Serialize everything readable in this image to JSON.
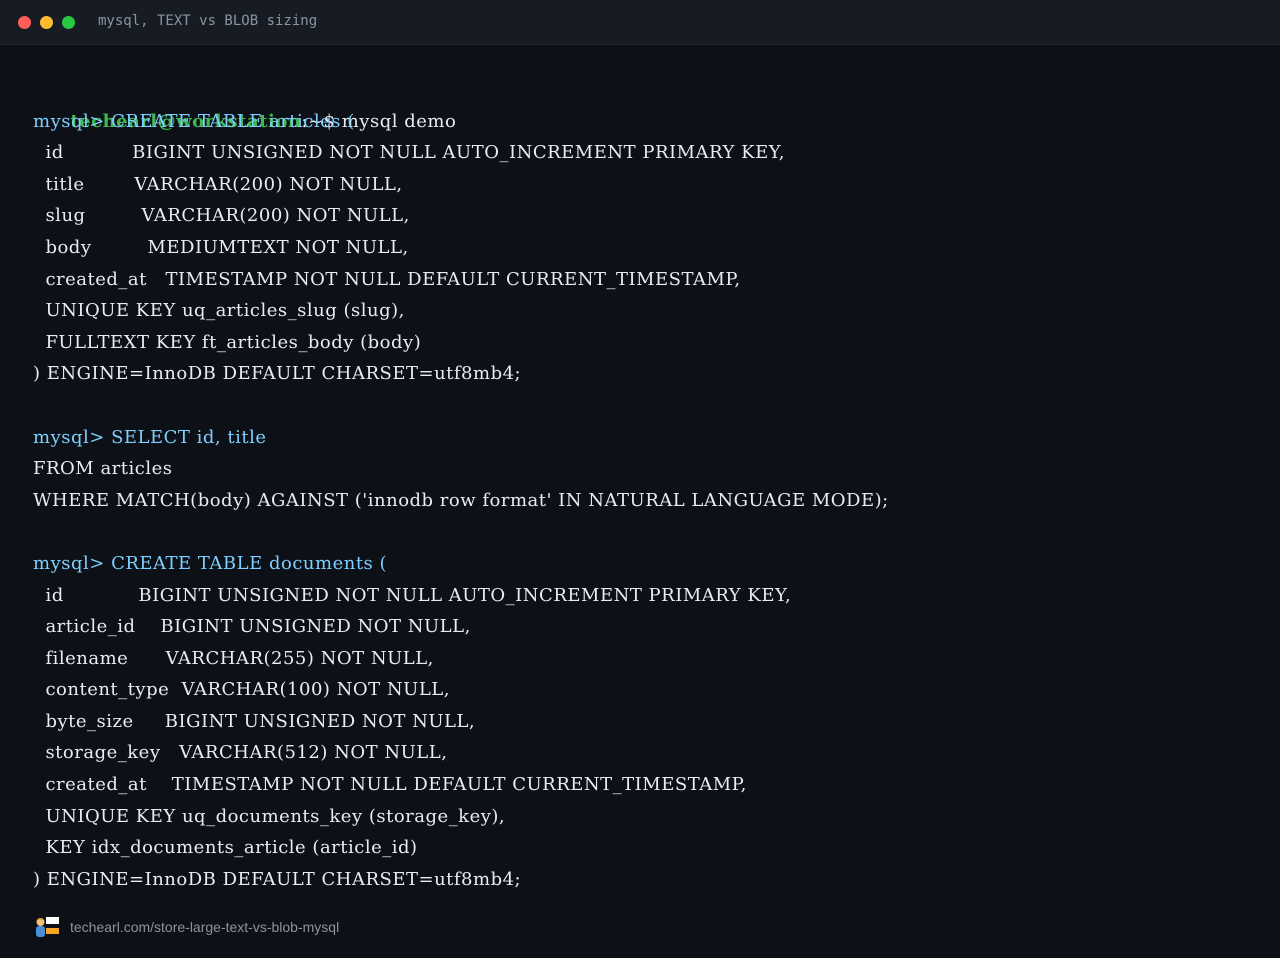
{
  "window": {
    "title": "mysql, TEXT vs BLOB sizing"
  },
  "terminal": {
    "shell_user": "techearl@workstation",
    "shell_path": ":~$ ",
    "shell_command": "mysql demo",
    "prompt": "mysql> ",
    "blocks": [
      {
        "first": "CREATE TABLE articles (",
        "lines": [
          "  id           BIGINT UNSIGNED NOT NULL AUTO_INCREMENT PRIMARY KEY,",
          "  title        VARCHAR(200) NOT NULL,",
          "  slug         VARCHAR(200) NOT NULL,",
          "  body         MEDIUMTEXT NOT NULL,",
          "  created_at   TIMESTAMP NOT NULL DEFAULT CURRENT_TIMESTAMP,",
          "  UNIQUE KEY uq_articles_slug (slug),",
          "  FULLTEXT KEY ft_articles_body (body)",
          ") ENGINE=InnoDB DEFAULT CHARSET=utf8mb4;"
        ]
      },
      {
        "first": "SELECT id, title",
        "lines": [
          "FROM articles",
          "WHERE MATCH(body) AGAINST ('innodb row format' IN NATURAL LANGUAGE MODE);"
        ]
      },
      {
        "first": "CREATE TABLE documents (",
        "lines": [
          "  id            BIGINT UNSIGNED NOT NULL AUTO_INCREMENT PRIMARY KEY,",
          "  article_id    BIGINT UNSIGNED NOT NULL,",
          "  filename      VARCHAR(255) NOT NULL,",
          "  content_type  VARCHAR(100) NOT NULL,",
          "  byte_size     BIGINT UNSIGNED NOT NULL,",
          "  storage_key   VARCHAR(512) NOT NULL,",
          "  created_at    TIMESTAMP NOT NULL DEFAULT CURRENT_TIMESTAMP,",
          "  UNIQUE KEY uq_documents_key (storage_key),",
          "  KEY idx_documents_article (article_id)",
          ") ENGINE=InnoDB DEFAULT CHARSET=utf8mb4;"
        ]
      }
    ]
  },
  "footer": {
    "logo_icon": "techearl-logo-icon",
    "url": "techearl.com/store-large-text-vs-blob-mysql"
  },
  "colors": {
    "background": "#0d1117",
    "titlebar": "#171c24",
    "user": "#3fb950",
    "prompt": "#7dcfff",
    "text": "#e6edf3",
    "muted": "#8b949e"
  }
}
